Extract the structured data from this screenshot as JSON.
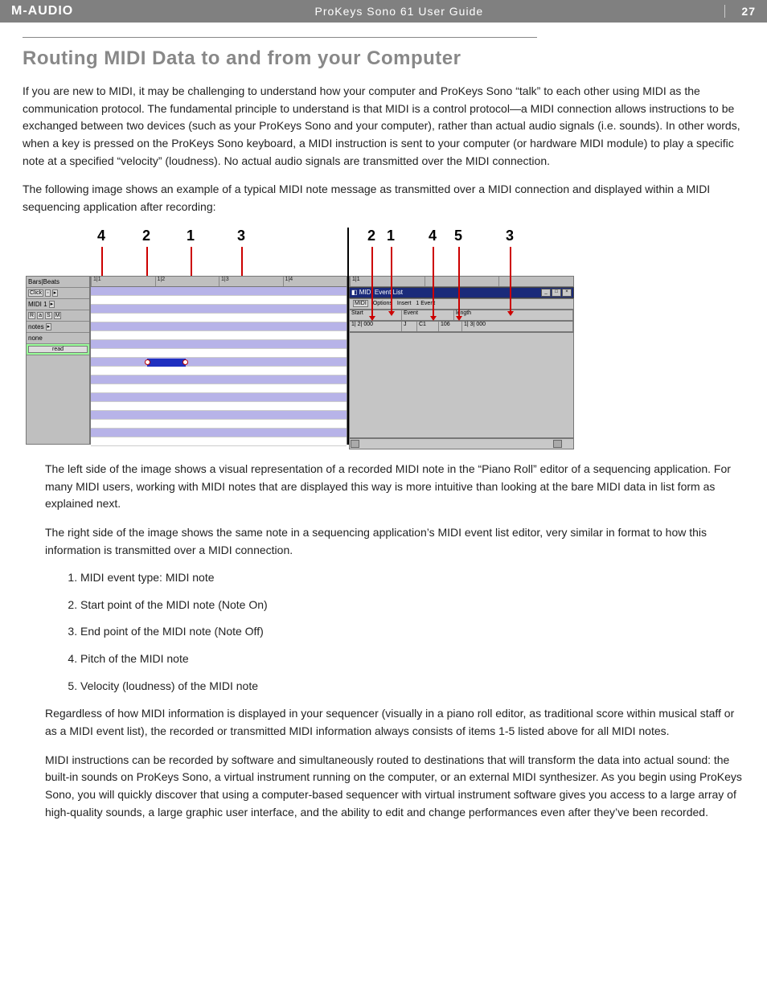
{
  "header": {
    "brand": "M-AUDIO",
    "doc_title": "ProKeys Sono 61 User Guide",
    "page_number": "27"
  },
  "title": "Routing MIDI Data to and from your Computer",
  "paragraphs": {
    "p1": "If you are new to MIDI, it may be challenging to understand how your computer and ProKeys Sono “talk” to each other using MIDI as the communication protocol.  The fundamental principle to understand is that MIDI is a control protocol—a MIDI connection allows instructions to be exchanged between two devices (such as your ProKeys Sono and your computer), rather than actual audio signals (i.e. sounds).  In other words, when a key is pressed on the ProKeys Sono keyboard, a MIDI instruction is sent to your computer (or hardware MIDI module) to play a specific note at a specified “velocity” (loudness).  No actual audio signals are transmitted over the MIDI connection.",
    "p2": "The following image shows an example of a typical MIDI note message as transmitted over a MIDI connection and displayed within a MIDI sequencing application after recording:",
    "p3": "The left side of the image shows a visual representation of a recorded MIDI note in the “Piano Roll” editor of a sequencing application. For many MIDI users, working with MIDI notes that are displayed this way is more intuitive than looking at the bare MIDI data in list form as explained next.",
    "p4": "The right side of the image shows the same note in a sequencing application’s MIDI event list editor, very similar in format to how this information is transmitted over a MIDI connection.",
    "p5": "Regardless of how MIDI information is displayed in your sequencer (visually in a piano roll editor, as traditional score within musical staff or as a MIDI event list), the recorded or transmitted MIDI information always consists of items 1-5 listed above for all MIDI notes.",
    "p6": "MIDI instructions can be recorded by software and simultaneously routed to destinations that will transform the data into actual sound: the built-in sounds on ProKeys Sono, a virtual instrument running on the computer, or an external MIDI synthesizer. As you begin using ProKeys Sono, you will quickly discover that using a computer-based sequencer with virtual instrument software gives you access to a large array of high-quality sounds, a large graphic user interface, and the ability to edit and change performances even after they’ve been recorded."
  },
  "list": {
    "i1": "MIDI event type: MIDI note",
    "i2": "Start point of the MIDI note (Note On)",
    "i3": "End point of the MIDI note (Note Off)",
    "i4": "Pitch of the MIDI note",
    "i5": "Velocity (loudness) of the MIDI note"
  },
  "figure": {
    "left_callouts": [
      "4",
      "2",
      "1",
      "3"
    ],
    "right_callouts": [
      "2",
      "1",
      "4",
      "5",
      "3"
    ],
    "piano_roll": {
      "header": "Bars|Beats",
      "timeline": [
        "1|1",
        "1|2",
        "1|3",
        "1|4"
      ],
      "side": {
        "r1": "Click",
        "r2": "MIDI 1",
        "r3_btns": [
          "R",
          "a",
          "S",
          "M"
        ],
        "r4": "notes",
        "r5": "none",
        "r6": "read"
      }
    },
    "event_list": {
      "timeline_left": "1|1",
      "window_title": "MIDI Event List",
      "toolbar": [
        "MIDI",
        "Options",
        "Insert",
        "1 Event"
      ],
      "columns": [
        "Start",
        "Event",
        "length"
      ],
      "row": [
        "1| 2| 000",
        "J",
        "C1",
        "106",
        "1| 3| 000"
      ]
    }
  }
}
